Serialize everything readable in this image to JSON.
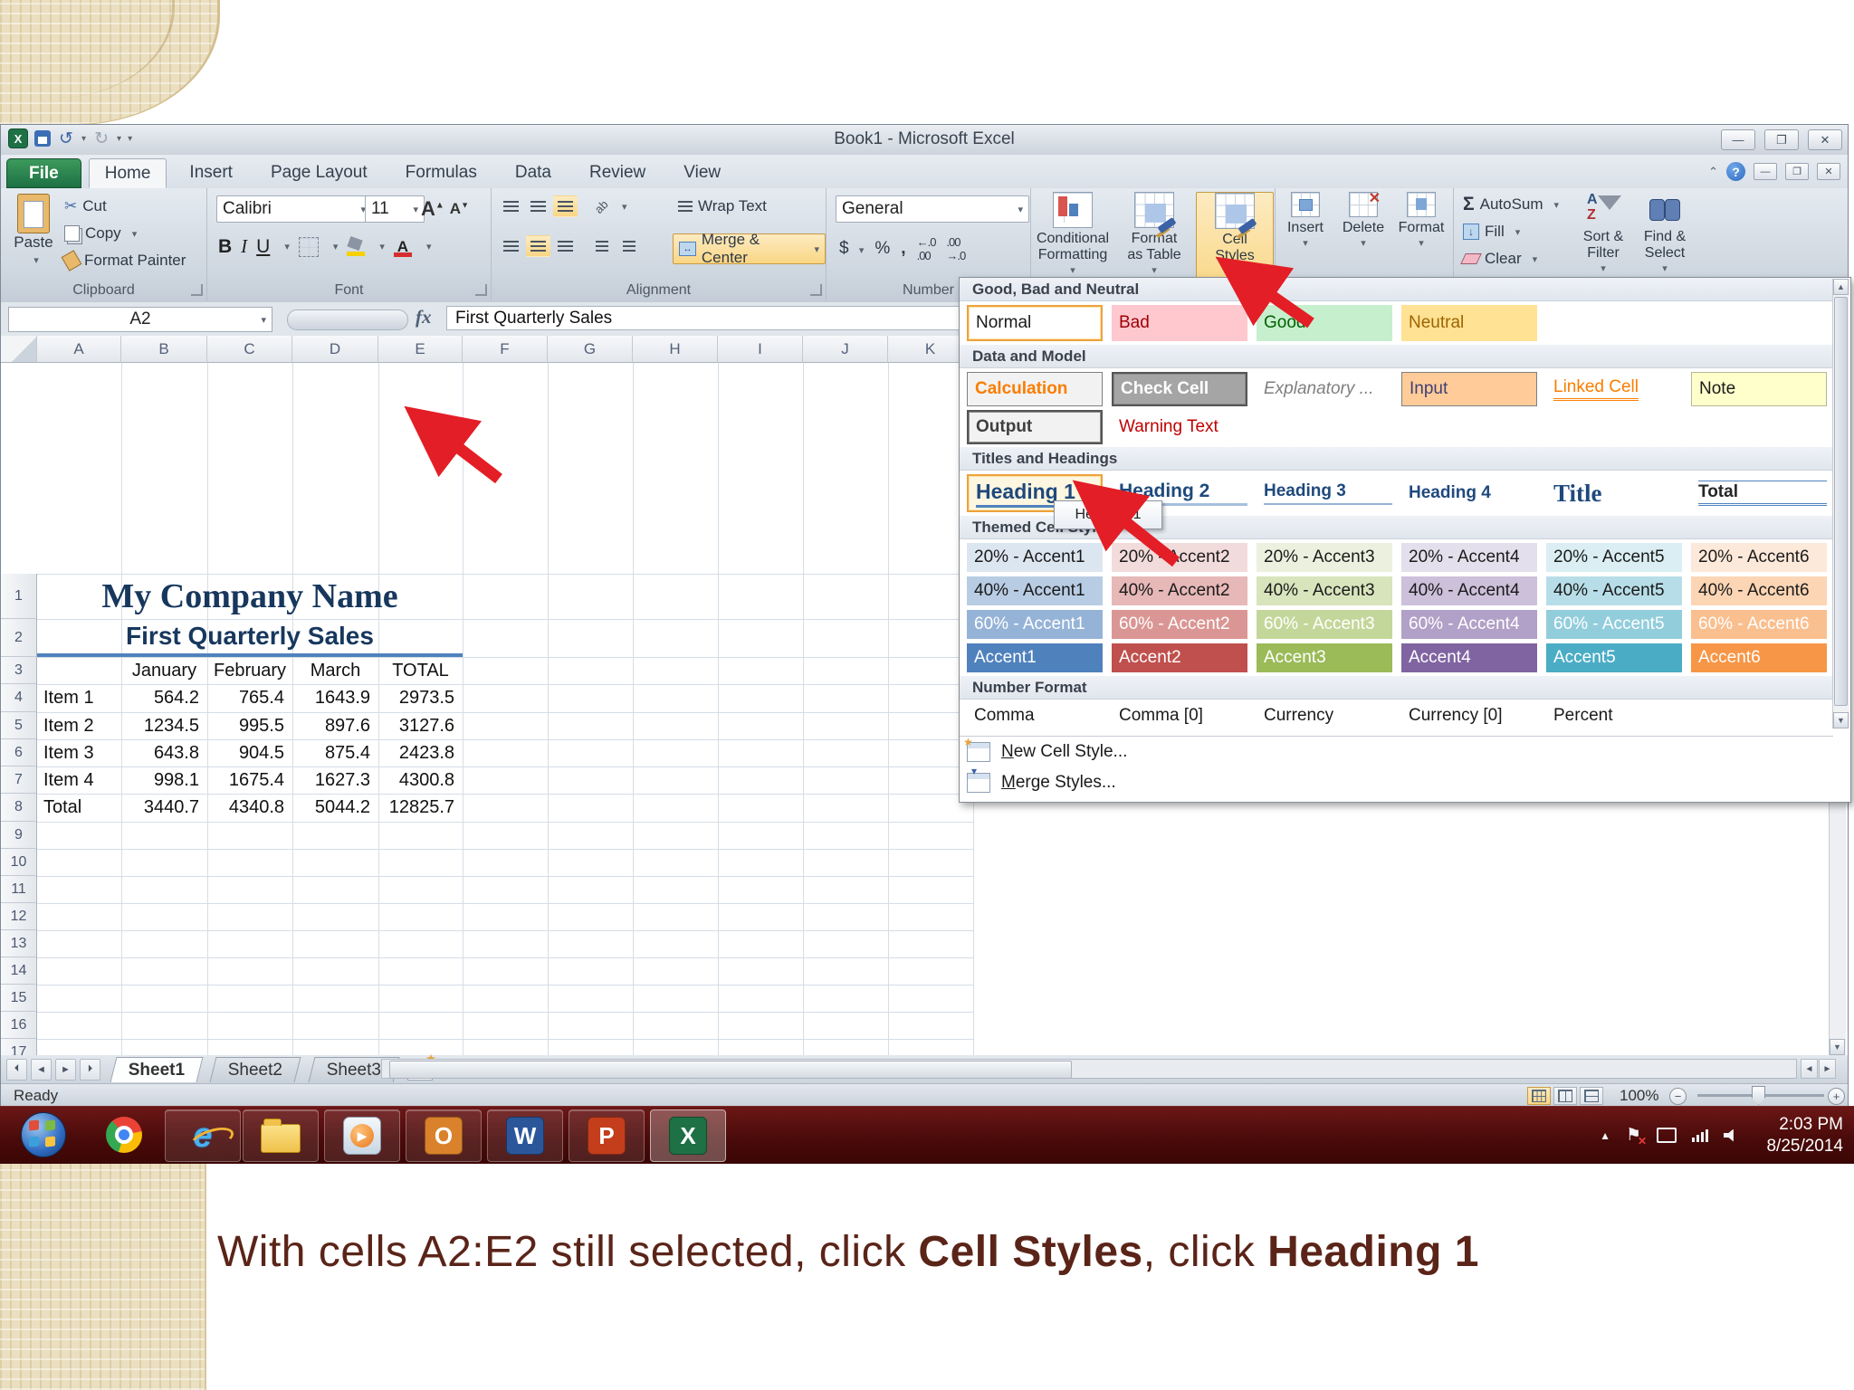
{
  "slide": {
    "caption": [
      {
        "t": "With cells A2:E2 still selected, click ",
        "b": false
      },
      {
        "t": "Cell Styles",
        "b": true
      },
      {
        "t": ", click ",
        "b": false
      },
      {
        "t": "Heading 1",
        "b": true
      }
    ],
    "caption_color": "#5B2418",
    "accent_beige": "#EADFC0"
  },
  "window": {
    "title": "Book1  -  Microsoft Excel",
    "tabs": [
      "File",
      "Home",
      "Insert",
      "Page Layout",
      "Formulas",
      "Data",
      "Review",
      "View"
    ],
    "active_tab": "Home"
  },
  "ribbon": {
    "clipboard": {
      "label": "Clipboard",
      "paste": "Paste",
      "cut": "Cut",
      "copy": "Copy",
      "painter": "Format Painter"
    },
    "font": {
      "label": "Font",
      "name": "Calibri",
      "size": "11"
    },
    "alignment": {
      "label": "Alignment",
      "wrap": "Wrap Text",
      "merge": "Merge & Center"
    },
    "number": {
      "label": "Number",
      "format": "General"
    },
    "styles": {
      "conditional": "Conditional Formatting",
      "table": "Format as Table",
      "cell": "Cell Styles"
    },
    "cells": {
      "insert": "Insert",
      "delete": "Delete",
      "format": "Format"
    },
    "editing": {
      "autosum": "AutoSum",
      "fill": "Fill",
      "clear": "Clear",
      "sort": "Sort & Filter",
      "find": "Find & Select"
    }
  },
  "formula_bar": {
    "name_box": "A2",
    "formula": "First Quarterly Sales"
  },
  "sheet": {
    "columns": [
      "A",
      "B",
      "C",
      "D",
      "E",
      "F",
      "G",
      "H",
      "I",
      "J",
      "K"
    ],
    "rows_visible": 25,
    "title": "My Company Name",
    "subtitle": "First Quarterly Sales",
    "table": {
      "headers": [
        "January",
        "February",
        "March",
        "TOTAL"
      ],
      "rows": [
        [
          "Item 1",
          "564.2",
          "765.4",
          "1643.9",
          "2973.5"
        ],
        [
          "Item 2",
          "1234.5",
          "995.5",
          "897.6",
          "3127.6"
        ],
        [
          "Item 3",
          "643.8",
          "904.5",
          "875.4",
          "2423.8"
        ],
        [
          "Item 4",
          "998.1",
          "1675.4",
          "1627.3",
          "4300.8"
        ],
        [
          "Total",
          "3440.7",
          "4340.8",
          "5044.2",
          "12825.7"
        ]
      ]
    },
    "tabs": [
      "Sheet1",
      "Sheet2",
      "Sheet3"
    ],
    "active_sheet": "Sheet1"
  },
  "status": {
    "mode": "Ready",
    "zoom": "100%"
  },
  "gallery": {
    "tooltip": "Heading 1",
    "sections": [
      {
        "title": "Good, Bad and Neutral",
        "rows": [
          [
            {
              "label": "Normal",
              "cls": "sel"
            },
            {
              "label": "Bad",
              "bg": "#FFC7CE",
              "fg": "#9C0006"
            },
            {
              "label": "Good",
              "bg": "#C6EFCE",
              "fg": "#006100"
            },
            {
              "label": "Neutral",
              "bg": "#FFE294",
              "fg": "#9C6500"
            }
          ]
        ]
      },
      {
        "title": "Data and Model",
        "rows": [
          [
            {
              "label": "Calculation",
              "bg": "#F2F2F2",
              "fg": "#FA7D00",
              "cls": "bordered bold"
            },
            {
              "label": "Check Cell",
              "bg": "#A5A5A5",
              "fg": "#FFFFFF",
              "cls": "checkcell bold"
            },
            {
              "label": "Explanatory ...",
              "fg": "#7F7F7F",
              "cls": "italic plain"
            },
            {
              "label": "Input",
              "bg": "#FFCC99",
              "fg": "#3F3F76",
              "cls": "bordered"
            },
            {
              "label": "Linked Cell",
              "fg": "#FA7D00",
              "cls": "linked plain"
            },
            {
              "label": "Note",
              "bg": "#FFFFCC",
              "cls": "bordered-light"
            }
          ],
          [
            {
              "label": "Output",
              "bg": "#F2F2F2",
              "fg": "#3F3F3F",
              "cls": "checkcell bold"
            },
            {
              "label": "Warning Text",
              "fg": "#C00000",
              "cls": "plain"
            }
          ]
        ]
      },
      {
        "title": "Titles and Headings",
        "rows": [
          [
            {
              "label": "Heading 1",
              "cls": "sel h1"
            },
            {
              "label": "Heading 2",
              "cls": "h2"
            },
            {
              "label": "Heading 3",
              "cls": "h3"
            },
            {
              "label": "Heading 4",
              "cls": "h4"
            },
            {
              "label": "Title",
              "cls": "titlefmt"
            },
            {
              "label": "Total",
              "cls": "totalfmt"
            }
          ]
        ]
      },
      {
        "title": "Themed Cell Styles",
        "rows": [
          [
            {
              "label": "20% - Accent1",
              "bg": "#DCE6F1"
            },
            {
              "label": "20% - Accent2",
              "bg": "#F2DCDB"
            },
            {
              "label": "20% - Accent3",
              "bg": "#EBF1DE"
            },
            {
              "label": "20% - Accent4",
              "bg": "#E4DFEC"
            },
            {
              "label": "20% - Accent5",
              "bg": "#DAEEF3"
            },
            {
              "label": "20% - Accent6",
              "bg": "#FDE9D9"
            }
          ],
          [
            {
              "label": "40% - Accent1",
              "bg": "#B8CCE4"
            },
            {
              "label": "40% - Accent2",
              "bg": "#E6B8B7"
            },
            {
              "label": "40% - Accent3",
              "bg": "#D8E4BC"
            },
            {
              "label": "40% - Accent4",
              "bg": "#CCC0DA"
            },
            {
              "label": "40% - Accent5",
              "bg": "#B7DEE8"
            },
            {
              "label": "40% - Accent6",
              "bg": "#FCD5B4"
            }
          ],
          [
            {
              "label": "60% - Accent1",
              "bg": "#95B3D7",
              "fg": "#FFFFFF"
            },
            {
              "label": "60% - Accent2",
              "bg": "#DA9694",
              "fg": "#FFFFFF"
            },
            {
              "label": "60% - Accent3",
              "bg": "#C4D79B",
              "fg": "#FFFFFF"
            },
            {
              "label": "60% - Accent4",
              "bg": "#B1A0C7",
              "fg": "#FFFFFF"
            },
            {
              "label": "60% - Accent5",
              "bg": "#92CDDC",
              "fg": "#FFFFFF"
            },
            {
              "label": "60% - Accent6",
              "bg": "#FABF8F",
              "fg": "#FFFFFF"
            }
          ],
          [
            {
              "label": "Accent1",
              "bg": "#4F81BD",
              "fg": "#FFFFFF"
            },
            {
              "label": "Accent2",
              "bg": "#C0504D",
              "fg": "#FFFFFF"
            },
            {
              "label": "Accent3",
              "bg": "#9BBB59",
              "fg": "#FFFFFF"
            },
            {
              "label": "Accent4",
              "bg": "#8064A2",
              "fg": "#FFFFFF"
            },
            {
              "label": "Accent5",
              "bg": "#4BACC6",
              "fg": "#FFFFFF"
            },
            {
              "label": "Accent6",
              "bg": "#F79646",
              "fg": "#FFFFFF"
            }
          ]
        ]
      },
      {
        "title": "Number Format",
        "rows": [
          [
            {
              "label": "Comma",
              "cls": "plain"
            },
            {
              "label": "Comma [0]",
              "cls": "plain"
            },
            {
              "label": "Currency",
              "cls": "plain"
            },
            {
              "label": "Currency [0]",
              "cls": "plain"
            },
            {
              "label": "Percent",
              "cls": "plain"
            }
          ]
        ]
      }
    ],
    "footer": [
      "New Cell Style...",
      "Merge Styles..."
    ]
  },
  "taskbar": {
    "apps": [
      "start",
      "chrome",
      "internet-explorer",
      "file-explorer",
      "media-player",
      "outlook",
      "word",
      "powerpoint",
      "excel"
    ],
    "active_app": "excel",
    "tray": [
      "tray-expand",
      "action-center",
      "display",
      "network",
      "volume"
    ],
    "time": "2:03 PM",
    "date": "8/25/2014"
  }
}
